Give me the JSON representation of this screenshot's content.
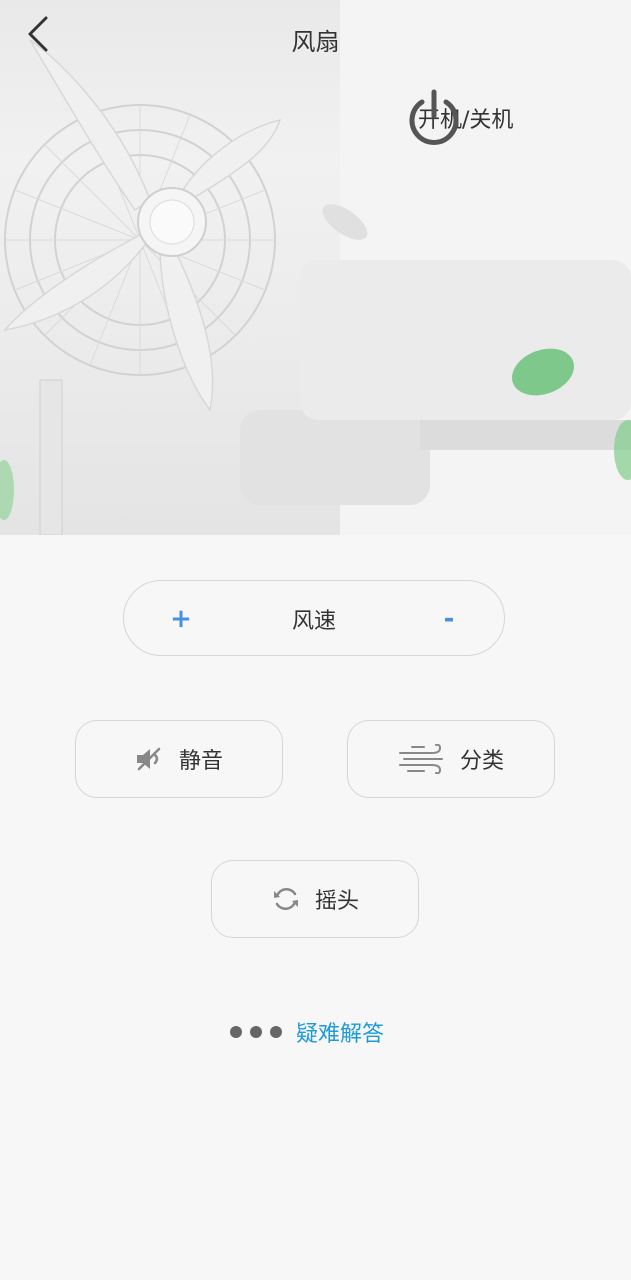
{
  "header": {
    "title": "风扇",
    "back_icon": "chevron-left-icon"
  },
  "power": {
    "label": "开机/关机",
    "icon": "power-icon"
  },
  "speed": {
    "label": "风速",
    "increase": "+",
    "decrease": "-",
    "accent_color": "#4a90e2"
  },
  "buttons": {
    "mute": {
      "label": "静音",
      "icon": "mute-icon"
    },
    "type": {
      "label": "分类",
      "icon": "wind-icon"
    },
    "swing": {
      "label": "摇头",
      "icon": "rotate-icon"
    }
  },
  "faq": {
    "label": "疑难解答",
    "color": "#1e9bd7"
  }
}
